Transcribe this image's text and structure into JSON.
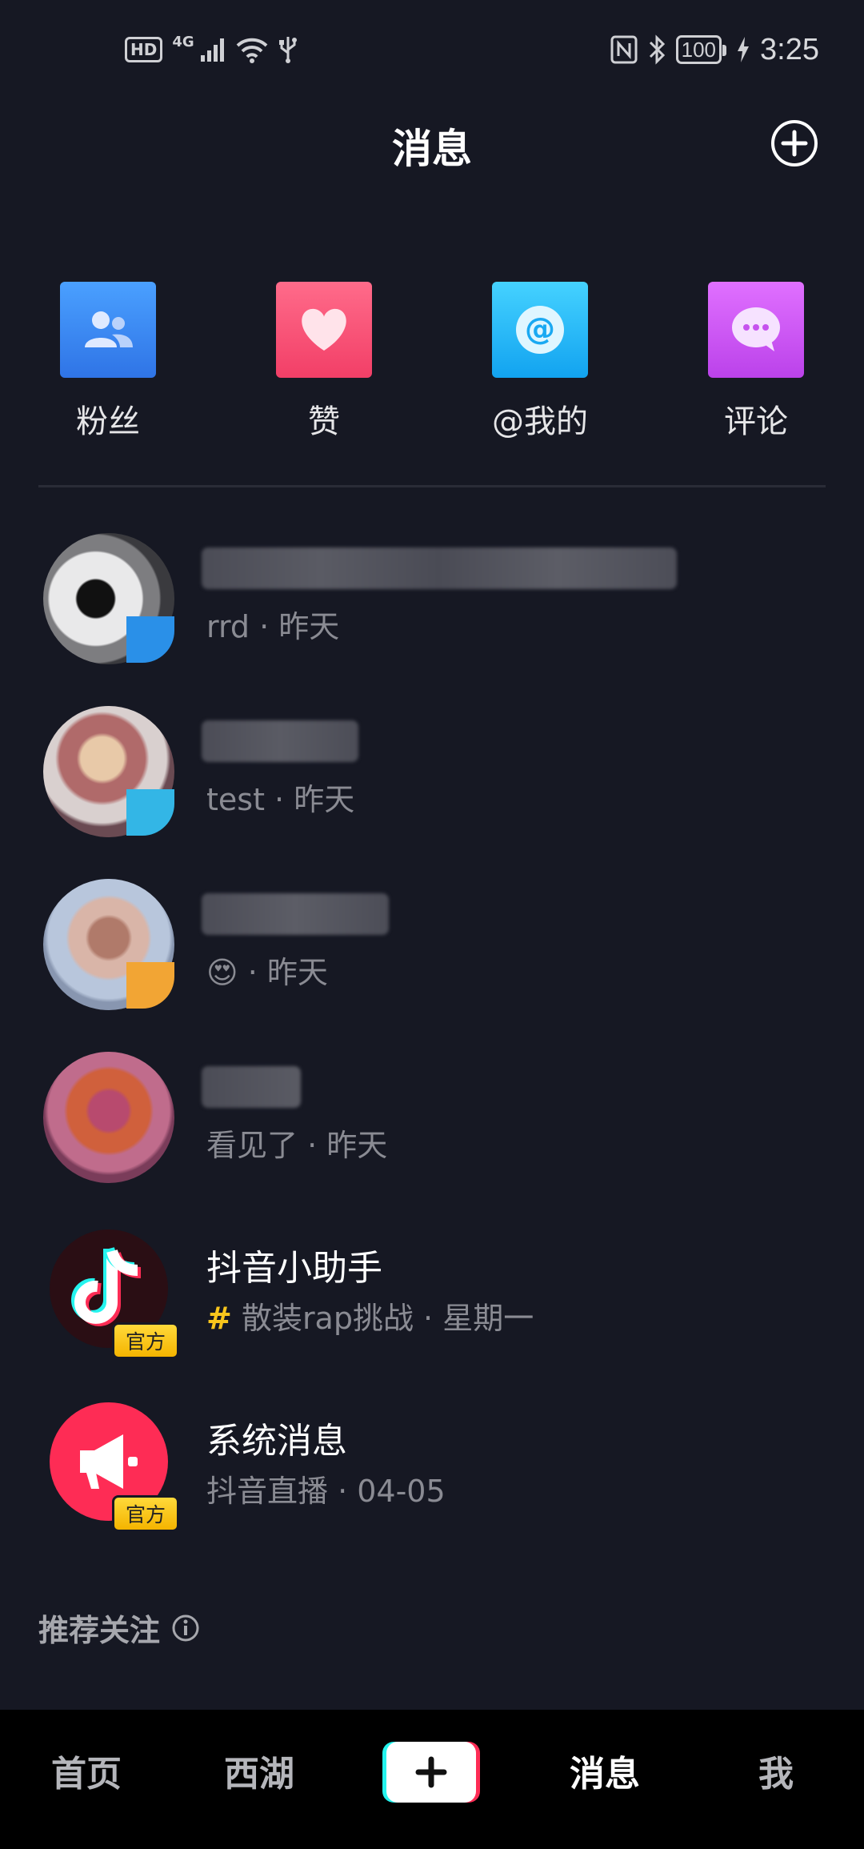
{
  "status_bar": {
    "hd": "HD",
    "network": "4G",
    "battery": "100",
    "time": "3:25"
  },
  "header": {
    "title": "消息"
  },
  "shortcuts": [
    {
      "label": "粉丝",
      "icon": "fans-icon",
      "color": "#3c8cf6"
    },
    {
      "label": "赞",
      "icon": "heart-icon",
      "color": "#f63f6a"
    },
    {
      "label": "@我的",
      "icon": "at-icon",
      "color": "#1ab1f5"
    },
    {
      "label": "评论",
      "icon": "comment-icon",
      "color": "#cb4ff0"
    }
  ],
  "conversations": [
    {
      "preview": "rrd · 昨天"
    },
    {
      "preview": "test · 昨天"
    },
    {
      "preview_emoji": "😍",
      "preview": " · 昨天"
    },
    {
      "preview": "看见了 · 昨天"
    },
    {
      "name": "抖音小助手",
      "badge": "官方",
      "preview_icon": "#",
      "preview": "散装rap挑战 · 星期一"
    },
    {
      "name": "系统消息",
      "badge": "官方",
      "preview": "抖音直播 · 04-05"
    }
  ],
  "recommend": {
    "label": "推荐关注",
    "icon": "info-icon"
  },
  "bottom_nav": {
    "items": [
      "首页",
      "西湖",
      "消息",
      "我"
    ],
    "active": "消息",
    "create": "+"
  },
  "colors": {
    "background": "#161823",
    "accent": "#fe2c55",
    "badge": "#f8c51c"
  }
}
